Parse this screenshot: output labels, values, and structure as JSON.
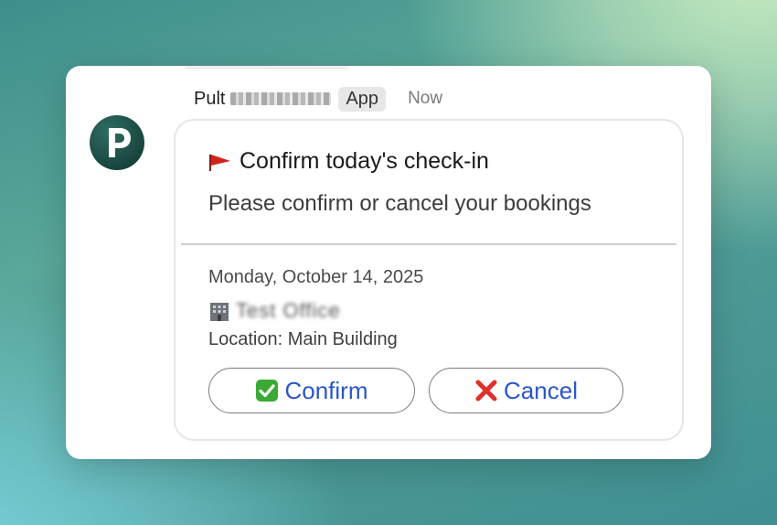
{
  "notification": {
    "app_name": "Pult",
    "app_badge": "App",
    "time": "Now",
    "title": "Confirm today's check-in",
    "subtitle": "Please confirm or cancel your bookings",
    "booking": {
      "date": "Monday, October 14, 2025",
      "office": "Test Office",
      "location": "Location: Main Building"
    },
    "actions": {
      "confirm_label": "Confirm",
      "cancel_label": "Cancel"
    },
    "icons": {
      "avatar": "pult-logo-icon",
      "title": "red-flag-icon",
      "office": "office-building-icon",
      "confirm": "check-mark-icon",
      "cancel": "cross-mark-icon"
    },
    "colors": {
      "action_text": "#2a56c8",
      "avatar_bg": "#18453e",
      "confirm_icon": "#3aaa35",
      "cancel_icon": "#e0302a"
    }
  }
}
